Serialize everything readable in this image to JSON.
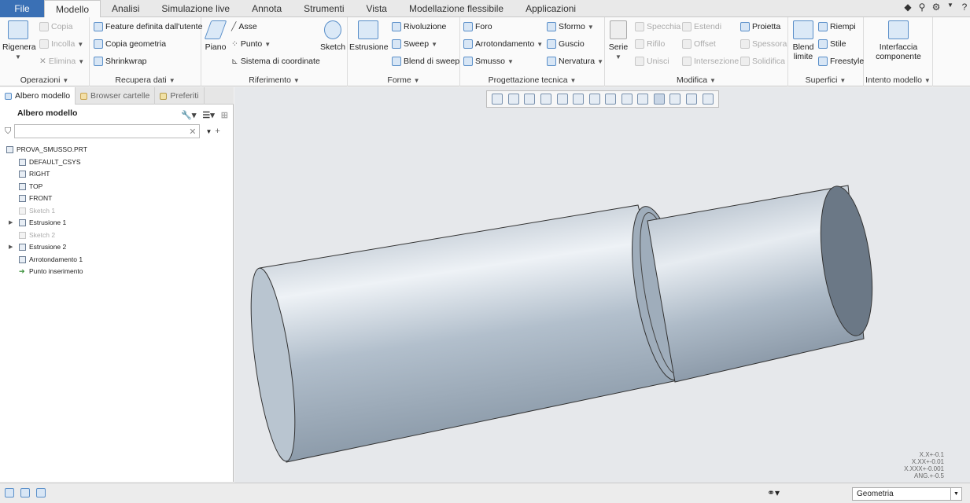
{
  "tabs": [
    "File",
    "Modello",
    "Analisi",
    "Simulazione live",
    "Annota",
    "Strumenti",
    "Vista",
    "Modellazione flessibile",
    "Applicazioni"
  ],
  "active_tab": "Modello",
  "ribbon": {
    "operazioni": {
      "label": "Operazioni",
      "rigenera": "Rigenera",
      "copia": "Copia",
      "incolla": "Incolla",
      "elimina": "Elimina"
    },
    "recupera": {
      "label": "Recupera dati",
      "feature": "Feature definita dall'utente",
      "copia_geom": "Copia geometria",
      "shrinkwrap": "Shrinkwrap"
    },
    "riferimento": {
      "label": "Riferimento",
      "piano": "Piano",
      "asse": "Asse",
      "punto": "Punto",
      "sistema": "Sistema di coordinate",
      "sketch": "Sketch"
    },
    "forme": {
      "label": "Forme",
      "estrusione": "Estrusione",
      "rivoluzione": "Rivoluzione",
      "sweep": "Sweep",
      "blend": "Blend di sweep"
    },
    "progettazione": {
      "label": "Progettazione tecnica",
      "foro": "Foro",
      "arrotondamento": "Arrotondamento",
      "smusso": "Smusso",
      "sformo": "Sformo",
      "guscio": "Guscio",
      "nervatura": "Nervatura"
    },
    "modifica": {
      "label": "Modifica",
      "serie": "Serie",
      "specchia": "Specchia",
      "rifilo": "Rifilo",
      "unisci": "Unisci",
      "estendi": "Estendi",
      "offset": "Offset",
      "intersezione": "Intersezione",
      "proietta": "Proietta",
      "spessora": "Spessora",
      "solidifica": "Solidifica"
    },
    "superfici": {
      "label": "Superfici",
      "blend_limite": "Blend limite",
      "riempi": "Riempi",
      "stile": "Stile",
      "freestyle": "Freestyle"
    },
    "intento": {
      "label": "Intento modello",
      "interfaccia": "Interfaccia componente"
    }
  },
  "panel_tabs": [
    "Albero modello",
    "Browser cartelle",
    "Preferiti"
  ],
  "panel_title": "Albero modello",
  "search_value": "",
  "tree": [
    {
      "label": "PROVA_SMUSSO.PRT",
      "dim": false,
      "expandable": false,
      "icon": "part-icon"
    },
    {
      "label": "DEFAULT_CSYS",
      "dim": false,
      "expandable": false,
      "icon": "csys-icon"
    },
    {
      "label": "RIGHT",
      "dim": false,
      "expandable": false,
      "icon": "plane-icon"
    },
    {
      "label": "TOP",
      "dim": false,
      "expandable": false,
      "icon": "plane-icon"
    },
    {
      "label": "FRONT",
      "dim": false,
      "expandable": false,
      "icon": "plane-icon"
    },
    {
      "label": "Sketch 1",
      "dim": true,
      "expandable": false,
      "icon": "sketch-icon"
    },
    {
      "label": "Estrusione 1",
      "dim": false,
      "expandable": true,
      "icon": "extrude-icon"
    },
    {
      "label": "Sketch 2",
      "dim": true,
      "expandable": false,
      "icon": "sketch-icon"
    },
    {
      "label": "Estrusione 2",
      "dim": false,
      "expandable": true,
      "icon": "extrude-icon"
    },
    {
      "label": "Arrotondamento 1",
      "dim": false,
      "expandable": false,
      "icon": "round-icon"
    },
    {
      "label": "Punto inserimento",
      "dim": false,
      "expandable": false,
      "icon": "insert-arrow-icon"
    }
  ],
  "tolerance": [
    "X.X+-0.1",
    "X.XX+-0.01",
    "X.XXX+-0.001",
    "ANG.+-0.5"
  ],
  "status": {
    "filter_value": "Geometria"
  },
  "colors": {
    "file_tab": "#3a70b5",
    "viewport_bg": "#e6e8eb",
    "shaft": "#b4c1cd"
  }
}
